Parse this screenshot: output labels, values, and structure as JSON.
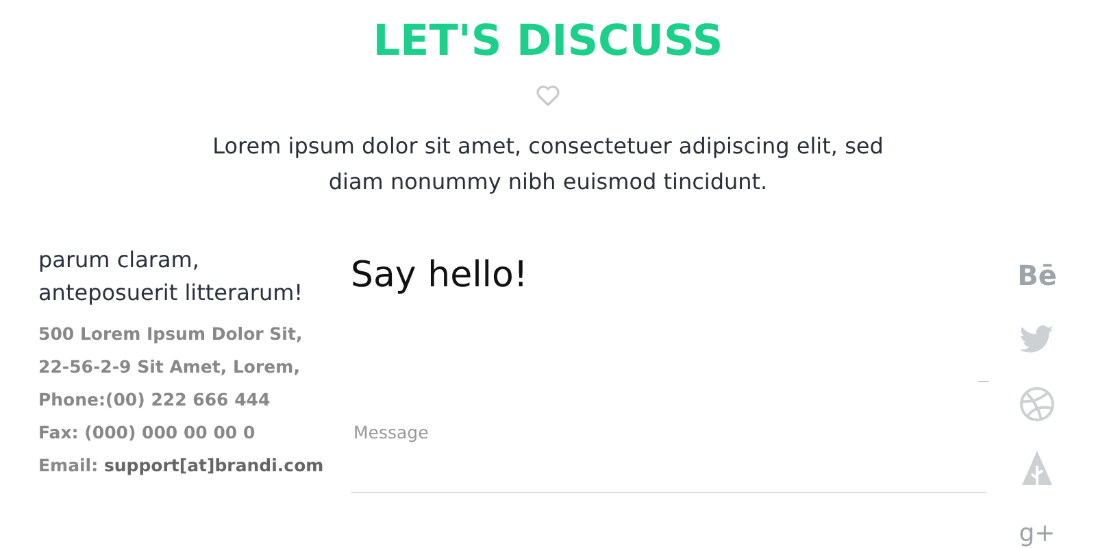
{
  "header": {
    "title": "LET'S DISCUSS",
    "intro": "Lorem ipsum dolor sit amet, consectetuer adipiscing elit, sed diam nonummy nibh euismod tincidunt."
  },
  "contact": {
    "heading": "parum claram, anteposuerit litterarum!",
    "lines": [
      "500 Lorem Ipsum Dolor Sit,",
      "22-56-2-9 Sit Amet, Lorem,",
      "Phone:(00) 222 666 444",
      "Fax: (000) 000 00 00 0"
    ],
    "email_label": "Email:",
    "email": "support[at]brandi.com"
  },
  "form": {
    "title": "Say hello!",
    "message": {
      "placeholder": "Message"
    }
  },
  "social": [
    {
      "kind": "behance",
      "glyph": "Bē"
    },
    {
      "kind": "twitter"
    },
    {
      "kind": "dribbble"
    },
    {
      "kind": "forrst"
    },
    {
      "kind": "googleplus",
      "glyph": "g+"
    }
  ]
}
